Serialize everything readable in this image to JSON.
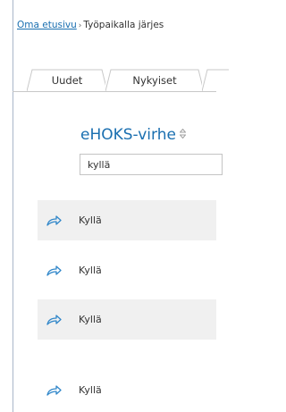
{
  "breadcrumb": {
    "home_link": "Oma etusivu",
    "separator": "›",
    "current": "Työpaikalla järjes"
  },
  "tabs": [
    {
      "label": "Uudet"
    },
    {
      "label": "Nykyiset"
    }
  ],
  "table": {
    "column_header": "eHOKS-virhe",
    "filter_value": "kyllä",
    "rows": [
      {
        "value": "Kyllä"
      },
      {
        "value": "Kyllä"
      },
      {
        "value": "Kyllä"
      },
      {
        "value": "Kyllä"
      }
    ]
  },
  "colors": {
    "link": "#1a6fb0",
    "row_shade": "#f0f0f0",
    "share_icon": "#2f86c9"
  },
  "icons": {
    "sort": "sort-icon",
    "row_action": "share-arrow-icon"
  }
}
